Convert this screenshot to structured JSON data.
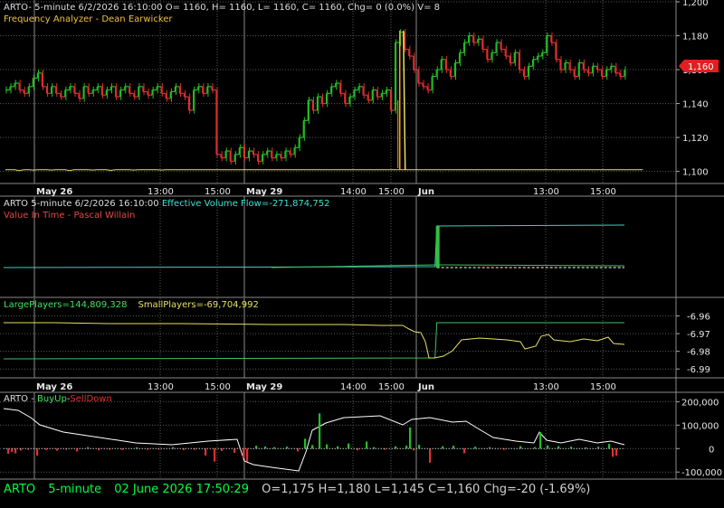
{
  "colors": {
    "background": "#000000",
    "grid": "#5a5a5a",
    "up": "#22c022",
    "down": "#e03030",
    "yellow": "#e8e060",
    "orange": "#f0a020",
    "cyan": "#40e0d0",
    "green_text": "#00ff40",
    "axis_text": "#e6e6e6"
  },
  "header": {
    "main_line": "ARTO- 5-minute 6/2/2026 16:10:00 O= 1160, H= 1160, L= 1160, C= 1160, Chg= 0 (0.0%) V= 8",
    "main_sub": "Frequency Analyzer - Dean Earwicker",
    "p2_line_a": "ARTO 5-minute  6/2/2026 16:10:00 ",
    "p2_line_b": "Effective Volume Flow=-271,874,752",
    "p2_sub": "Value In Time - Pascal Willain",
    "p3_a": "LargePlayers=144,809,328",
    "p3_b": "SmallPlayers=-69,704,992",
    "p4_a": "ARTO",
    "p4_sep": " - ",
    "p4_b": "BuyUp",
    "p4_dash": "-",
    "p4_c": "SellDown"
  },
  "status_bar": {
    "symbol": "ARTO",
    "interval": "5-minute",
    "datetime": "02 June 2026 17:50:29",
    "ohlc": "O=1,175  H=1,180  L=1,145  C=1,160  Chg=-20 (-1.69%)"
  },
  "chart_data": [
    {
      "name_ref": "price",
      "type": "bar",
      "x_axis": {
        "ticks": [
          "May 26",
          "13:00",
          "15:00",
          "May 29",
          "14:00",
          "15:00",
          "Jun",
          "13:00",
          "15:00"
        ],
        "day_ticks": [
          "May 26",
          "May 29",
          "Jun"
        ]
      },
      "y_axis": {
        "ticks": [
          "1,200",
          "1,180",
          "1,160",
          "1,140",
          "1,120",
          "1,100"
        ],
        "range": [
          1095,
          1200
        ]
      },
      "last_value_label": "1,160",
      "close_series": [
        1148,
        1150,
        1152,
        1148,
        1146,
        1150,
        1155,
        1158,
        1150,
        1146,
        1150,
        1146,
        1144,
        1148,
        1150,
        1146,
        1143,
        1150,
        1146,
        1148,
        1150,
        1145,
        1148,
        1150,
        1144,
        1148,
        1150,
        1146,
        1144,
        1150,
        1147,
        1145,
        1148,
        1150,
        1146,
        1143,
        1147,
        1150,
        1146,
        1144,
        1136,
        1148,
        1150,
        1146,
        1150,
        1148,
        1110,
        1108,
        1112,
        1106,
        1110,
        1114,
        1108,
        1112,
        1110,
        1106,
        1110,
        1112,
        1108,
        1110,
        1108,
        1112,
        1110,
        1114,
        1120,
        1130,
        1142,
        1136,
        1144,
        1140,
        1146,
        1150,
        1152,
        1146,
        1140,
        1144,
        1148,
        1150,
        1145,
        1142,
        1148,
        1144,
        1146,
        1148,
        1136,
        1176,
        1182,
        1172,
        1168,
        1160,
        1152,
        1150,
        1148,
        1156,
        1160,
        1166,
        1160,
        1156,
        1164,
        1170,
        1176,
        1180,
        1176,
        1178,
        1172,
        1166,
        1170,
        1176,
        1172,
        1168,
        1164,
        1170,
        1160,
        1156,
        1162,
        1166,
        1168,
        1170,
        1180,
        1176,
        1166,
        1160,
        1164,
        1160,
        1156,
        1164,
        1160,
        1158,
        1162,
        1160,
        1156,
        1160,
        1162,
        1158,
        1156,
        1160
      ],
      "freq_series": [
        1101,
        1101,
        1101,
        1100.5,
        1101,
        1101,
        1100.8,
        1101,
        1101,
        1101,
        1100.8,
        1101,
        1101,
        1101,
        1100.5,
        1101,
        1101,
        1101,
        1101,
        1100.8,
        1101,
        1101,
        1101,
        1100.6,
        1101,
        1101,
        1101,
        1101,
        1100.8,
        1101,
        1101,
        1101,
        1101,
        1101,
        1100.8,
        1101,
        1101,
        1101,
        1101,
        1101,
        1101,
        1101,
        1101,
        1101,
        1101,
        1101,
        1101,
        1101,
        1101,
        1101,
        1101,
        1101,
        1101,
        1101,
        1101,
        1101,
        1101,
        1101,
        1101,
        1101,
        1101,
        1101,
        1101,
        1101,
        1101,
        1101,
        1101,
        1101,
        1101,
        1101,
        1101,
        1101,
        1101,
        1101,
        1101,
        1101,
        1101,
        1101,
        1101,
        1101,
        1101,
        1101,
        1101,
        1101,
        1101,
        1101,
        1101,
        1101,
        1101,
        1101,
        1101,
        1101,
        1101,
        1101,
        1101,
        1101,
        1101,
        1101,
        1101,
        1101,
        1101,
        1101,
        1101,
        1101,
        1101,
        1101,
        1101,
        1101,
        1101,
        1101,
        1101,
        1101,
        1101,
        1101,
        1101,
        1101,
        1101,
        1101,
        1101,
        1101,
        1101,
        1101,
        1101,
        1101,
        1101,
        1101,
        1101,
        1101,
        1101,
        1101,
        1101,
        1101,
        1101,
        1101,
        1101,
        1101,
        1101,
        1101,
        1101,
        1101
      ]
    },
    {
      "name_ref": "effective_volume_flow",
      "type": "line",
      "series_a_shape": {
        "before": 0,
        "jump_at_fraction": 0.646,
        "after": 1
      },
      "series_b_shape": {
        "before": 0,
        "after": 0
      }
    },
    {
      "name_ref": "players",
      "type": "line",
      "y_axis": {
        "ticks": [
          "-6.96",
          "-6.97",
          "-6.98",
          "-6.99"
        ],
        "range": [
          -6.995,
          -6.95
        ]
      },
      "x_axis": {
        "ticks": [
          "May 26",
          "13:00",
          "15:00",
          "May 29",
          "14:00",
          "15:00",
          "Jun",
          "13:00",
          "15:00"
        ]
      }
    },
    {
      "name_ref": "buyup_selldown",
      "type": "bar",
      "y_axis": {
        "ticks": [
          "200,000",
          "100,000",
          "0",
          "-100,000"
        ],
        "range": [
          -130000,
          240000
        ]
      }
    }
  ]
}
